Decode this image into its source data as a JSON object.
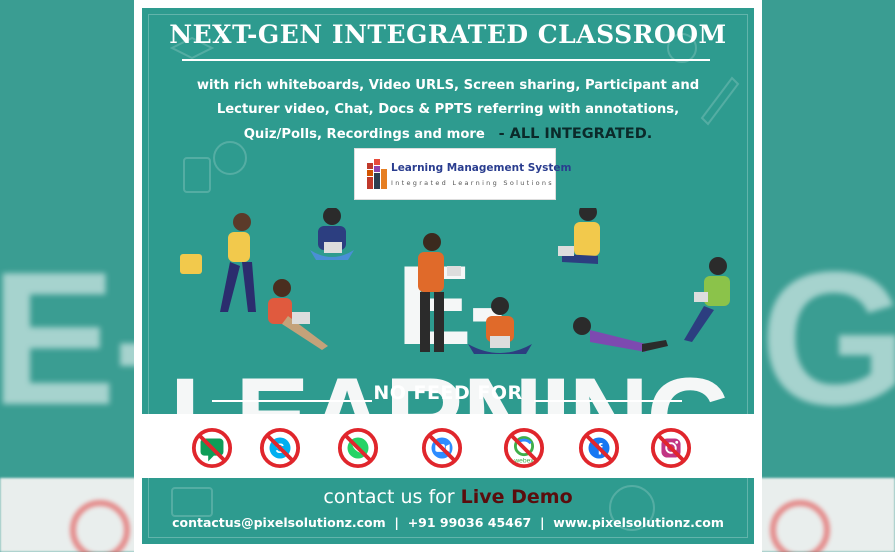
{
  "title": "NEXT-GEN INTEGRATED CLASSROOM",
  "description": {
    "line1": "with rich whiteboards, Video URLS, Screen sharing, Participant and",
    "line2": "Lecturer video, Chat, Docs & PPTS referring with annotations,",
    "line3": "Quiz/Polls, Recordings and more",
    "highlight": "- ALL INTEGRATED."
  },
  "lms": {
    "name": "Learning Management System",
    "tagline": "Integrated Learning Solutions"
  },
  "hero_word": "E-LEARNING",
  "backdrop_word_left": "E-LE",
  "backdrop_word_right": "G",
  "no_feed_label": "NO FEED FOR",
  "apps": [
    {
      "icon": "hangouts-icon",
      "color": "#0f9d58"
    },
    {
      "icon": "skype-icon",
      "color": "#00aff0"
    },
    {
      "icon": "whatsapp-icon",
      "color": "#25d366"
    },
    {
      "icon": "zoom-icon",
      "color": "#2d8cff"
    },
    {
      "icon": "webex-icon",
      "color": "#3fae49"
    },
    {
      "icon": "facebook-icon",
      "color": "#1877f2"
    },
    {
      "icon": "instagram-icon",
      "color": "#c13584"
    }
  ],
  "contact": {
    "prefix": "contact us for",
    "demo": "Live Demo",
    "email": "contactus@pixelsolutionz.com",
    "phone": "+91 99036 45467",
    "website": "www.pixelsolutionz.com",
    "separator": "|"
  },
  "colors": {
    "teal": "#2e9b8f",
    "ban_red": "#e0262c",
    "demo": "#5a0d0d"
  }
}
